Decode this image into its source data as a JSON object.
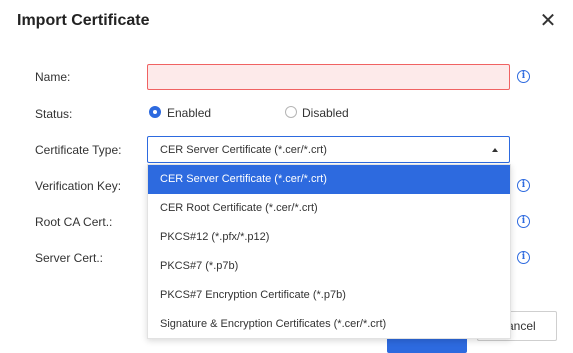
{
  "dialog": {
    "title": "Import Certificate",
    "close_glyph": "✕",
    "cancel_label": "Cancel"
  },
  "form": {
    "name_label": "Name:",
    "name_value": "",
    "status_label": "Status:",
    "status_options": [
      "Enabled",
      "Disabled"
    ],
    "status_selected": "Enabled",
    "cert_type_label": "Certificate Type:",
    "cert_type_value": "CER Server Certificate (*.cer/*.crt)",
    "verification_key_label": "Verification Key:",
    "root_ca_label": "Root CA Cert.:",
    "server_cert_label": "Server Cert.:",
    "info_glyph": "i"
  },
  "dropdown": {
    "options": [
      "CER Server Certificate (*.cer/*.crt)",
      "CER Root Certificate (*.cer/*.crt)",
      "PKCS#12  (*.pfx/*.p12)",
      "PKCS#7 (*.p7b)",
      "PKCS#7 Encryption Certificate (*.p7b)",
      "Signature & Encryption Certificates (*.cer/*.crt)"
    ],
    "selected_index": 0
  },
  "colors": {
    "accent": "#2d6adf",
    "error_border": "#f06262",
    "error_fill": "#fdeaea"
  },
  "icons": {
    "close": "close-icon",
    "info": "info-icon",
    "dropdown_arrow": "caret-up-icon"
  }
}
